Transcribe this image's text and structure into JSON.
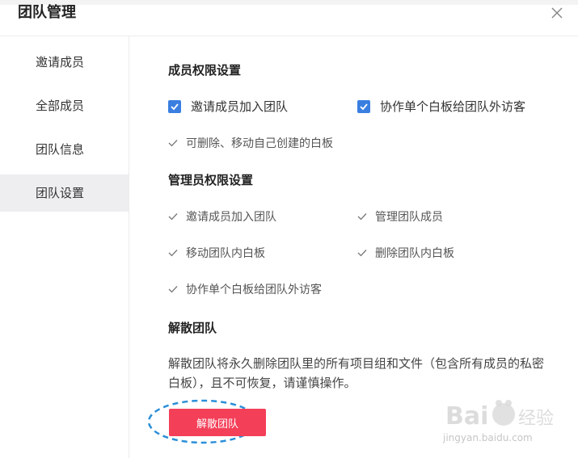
{
  "dialog": {
    "title": "团队管理"
  },
  "sidebar": {
    "items": [
      {
        "label": "邀请成员",
        "active": false
      },
      {
        "label": "全部成员",
        "active": false
      },
      {
        "label": "团队信息",
        "active": false
      },
      {
        "label": "团队设置",
        "active": true
      }
    ]
  },
  "member_permissions": {
    "title": "成员权限设置",
    "checkboxes": [
      {
        "label": "邀请成员加入团队",
        "checked": true
      },
      {
        "label": "协作单个白板给团队外访客",
        "checked": true
      }
    ],
    "fixed": [
      "可删除、移动自己创建的白板"
    ]
  },
  "admin_permissions": {
    "title": "管理员权限设置",
    "items": [
      "邀请成员加入团队",
      "管理团队成员",
      "移动团队内白板",
      "删除团队内白板",
      "协作单个白板给团队外访客"
    ]
  },
  "dissolve": {
    "title": "解散团队",
    "description": "解散团队将永久删除团队里的所有项目组和文件（包含所有成员的私密白板），且不可恢复，请谨慎操作。",
    "button_label": "解散团队"
  },
  "watermark": {
    "text": "jingyan.baidu.com"
  },
  "colors": {
    "accent": "#3a7fe0",
    "danger": "#f43f59",
    "annotation": "#2c8fd8"
  }
}
